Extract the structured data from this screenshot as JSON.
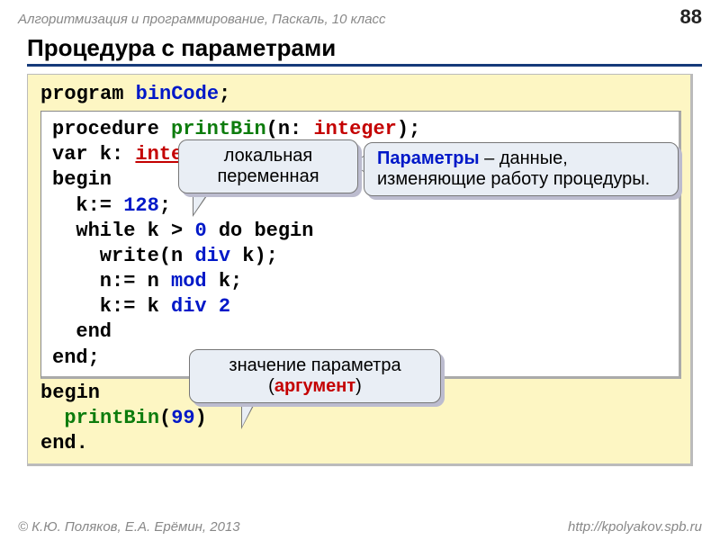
{
  "header": {
    "breadcrumb": "Алгоритмизация и программирование, Паскаль, 10 класс",
    "pagenum": "88"
  },
  "title": "Процедура с параметрами",
  "code": {
    "prog_kw": "program ",
    "prog_name": "binCode",
    "semi": ";",
    "proc_kw": "procedure ",
    "proc_name": "printBin",
    "proc_sig_open": "(n: ",
    "int_type": "integer",
    "proc_sig_close": ");",
    "var_line_a": "var k: ",
    "var_line_b": "integer",
    "var_line_c": ";",
    "begin1": "begin",
    "l1a": "  k:= ",
    "l1b": "128",
    "l1c": ";",
    "l2a": "  while k > ",
    "l2b": "0",
    "l2c": " do begin",
    "l3a": "    write(n ",
    "l3b": "div",
    "l3c": " k);",
    "l4a": "    n:= n ",
    "l4b": "mod",
    "l4c": " k;",
    "l5a": "    k:= k ",
    "l5b": "div",
    "l5c": " ",
    "l5d": "2",
    "l6": "  end",
    "end1": "end;",
    "begin2": "begin",
    "call_a": "  ",
    "call_name": "printBin",
    "call_open": "(",
    "call_arg": "99",
    "call_close": ")",
    "end2": "end."
  },
  "callouts": {
    "c1": "локальная переменная",
    "c2_kw": "Параметры",
    "c2_rest": " – данные, изменяющие работу процедуры.",
    "c3_a": "значение параметра (",
    "c3_kw": "аргумент",
    "c3_b": ")"
  },
  "footer": {
    "left": "© К.Ю. Поляков, Е.А. Ерёмин, 2013",
    "right": "http://kpolyakov.spb.ru"
  }
}
